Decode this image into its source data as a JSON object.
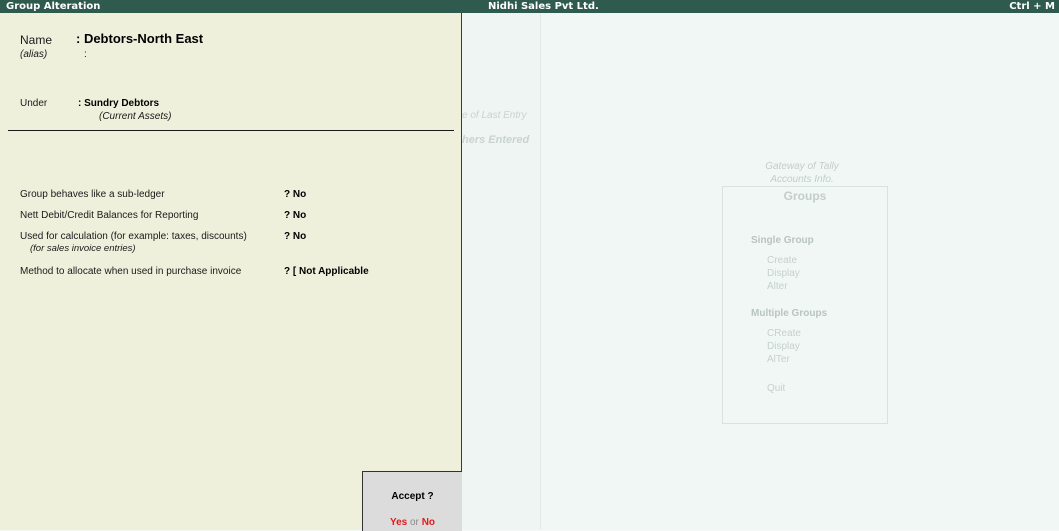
{
  "titlebar": {
    "left": "Group Alteration",
    "center": "Nidhi Sales Pvt Ltd.",
    "right": "Ctrl + M"
  },
  "background": {
    "last_entry": "e of Last Entry",
    "vouchers_entered": "hers Entered",
    "gateway_title": "Gateway of Tally",
    "gateway_subtitle": "Accounts Info.",
    "menu": {
      "title": "Groups",
      "single_group": "Single Group",
      "single_items": [
        "Create",
        "Display",
        "Alter"
      ],
      "multiple_groups": "Multiple Groups",
      "multiple_items": [
        "CReate",
        "Display",
        "AlTer"
      ],
      "quit": "Quit"
    }
  },
  "form": {
    "name_label": "Name",
    "name_value": ": Debtors-North East",
    "alias_label": "(alias)",
    "alias_value": ":",
    "under_label": "Under",
    "under_value": ": Sundry Debtors",
    "under_sub": "(Current Assets)",
    "fields": [
      {
        "label": "Group behaves like a sub-ledger",
        "value": "? No"
      },
      {
        "label": "Nett Debit/Credit Balances for Reporting",
        "value": "? No"
      },
      {
        "label": "Used for calculation (for example: taxes, discounts)",
        "sub": "(for sales invoice entries)",
        "value": "? No"
      },
      {
        "label": "Method to allocate when used in purchase invoice",
        "value": "? [  Not Applicable"
      }
    ]
  },
  "accept": {
    "question": "Accept ?",
    "yes": "Yes",
    "or": "or",
    "no": "No"
  }
}
